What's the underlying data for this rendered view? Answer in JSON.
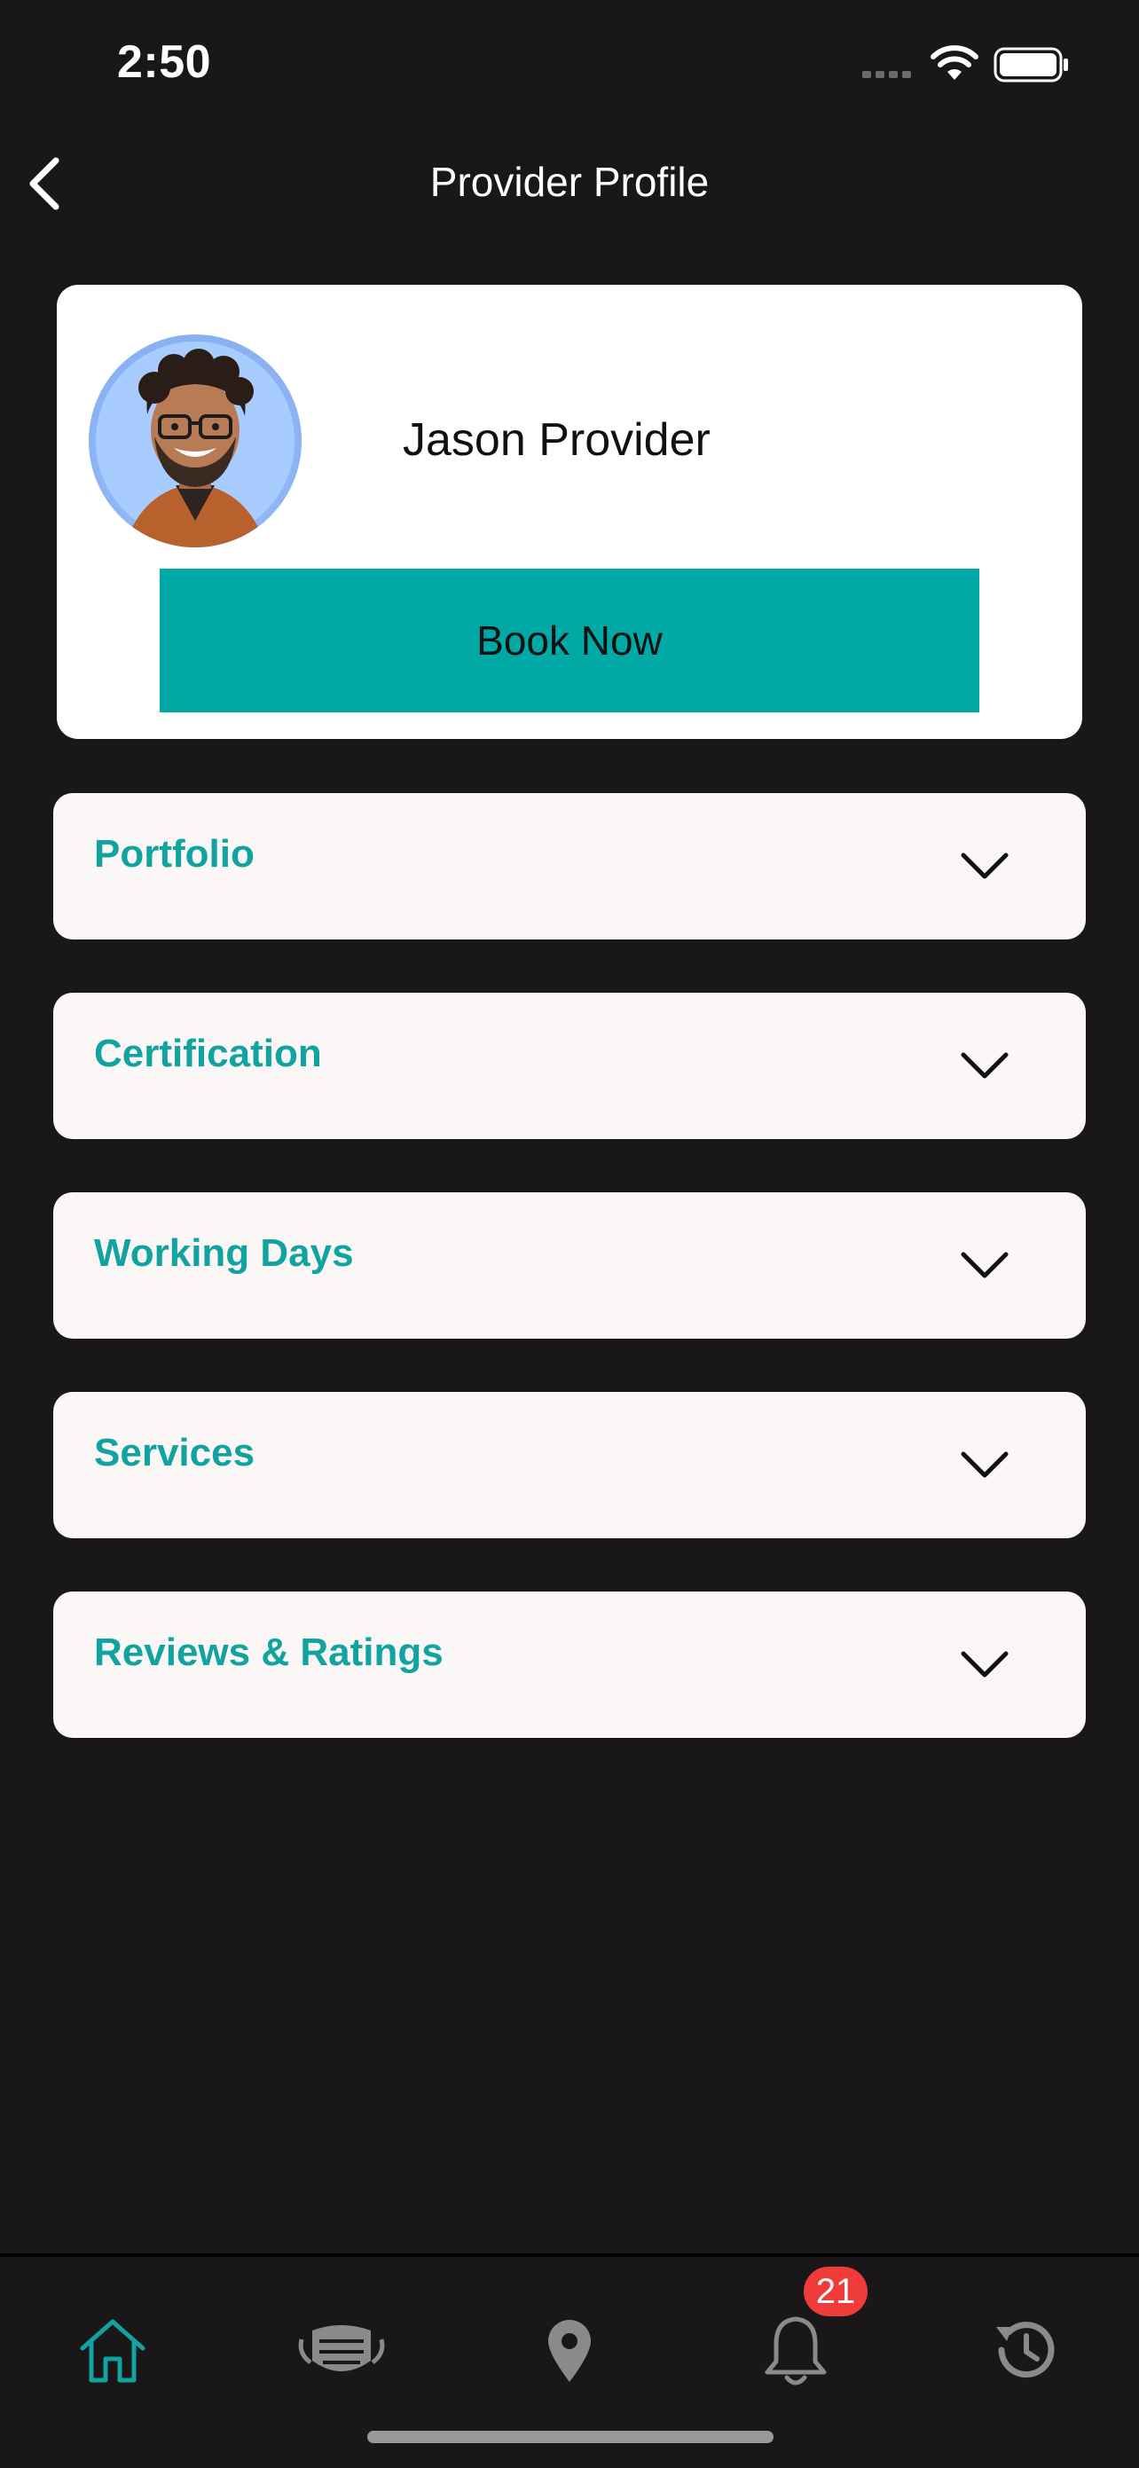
{
  "status_bar": {
    "time": "2:50"
  },
  "header": {
    "title": "Provider Profile",
    "back_icon": "chevron-left-icon"
  },
  "profile": {
    "name": "Jason Provider",
    "book_button_label": "Book Now"
  },
  "sections": [
    {
      "label": "Portfolio"
    },
    {
      "label": "Certification"
    },
    {
      "label": "Working Days"
    },
    {
      "label": "Services"
    },
    {
      "label": "Reviews & Ratings"
    }
  ],
  "bottom_nav": {
    "items": [
      {
        "icon": "home-icon",
        "active": true
      },
      {
        "icon": "face-mask-icon",
        "active": false
      },
      {
        "icon": "location-pin-icon",
        "active": false
      },
      {
        "icon": "bell-icon",
        "active": false
      },
      {
        "icon": "history-icon",
        "active": false
      }
    ],
    "notification_badge": "21"
  },
  "colors": {
    "background": "#1a1718",
    "accent": "#00a9a5",
    "section_label": "#10a3a0",
    "badge": "#f03b3b"
  }
}
